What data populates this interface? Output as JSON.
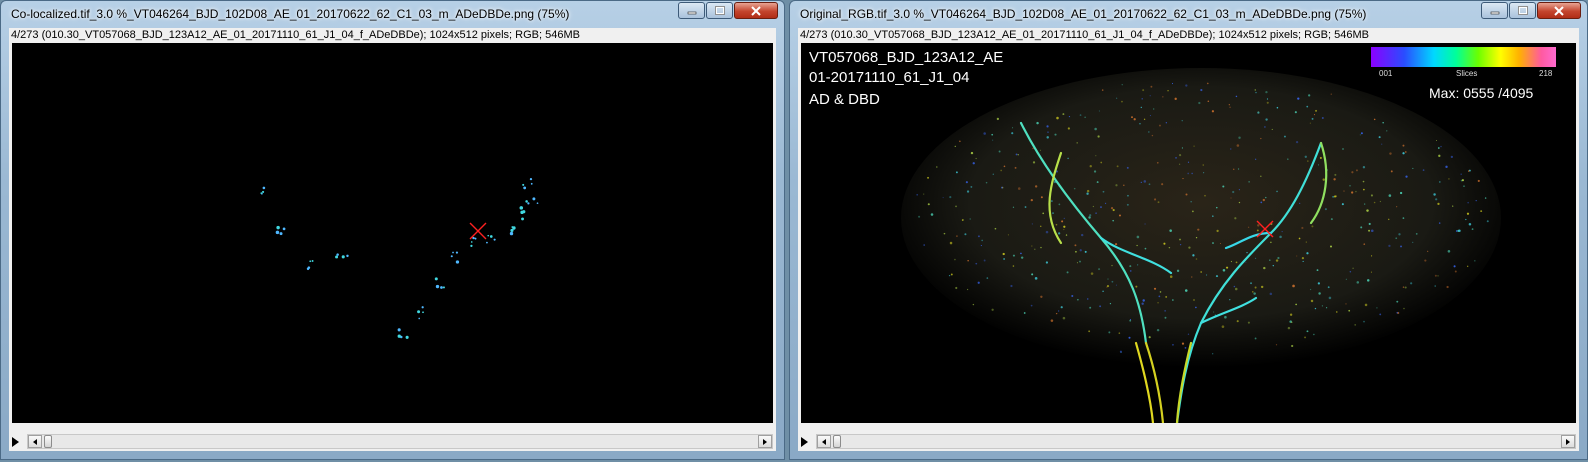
{
  "left_window": {
    "title": "Co-localized.tif_3.0 %_VT046264_BJD_102D08_AE_01_20170622_62_C1_03_m_ADeDBDe.png (75%)",
    "info": "4/273 (010.30_VT057068_BJD_123A12_AE_01_20171110_61_J1_04_f_ADeDBDe); 1024x512 pixels; RGB; 546MB"
  },
  "right_window": {
    "title": "Original_RGB.tif_3.0 %_VT046264_BJD_102D08_AE_01_20170622_62_C1_03_m_ADeDBDe.png (75%)",
    "info": "4/273 (010.30_VT057068_BJD_123A12_AE_01_20171110_61_J1_04_f_ADeDBDe); 1024x512 pixels; RGB; 546MB",
    "overlay_line1": "VT057068_BJD_123A12_AE",
    "overlay_line2": "01-20171110_61_J1_04",
    "overlay_line3": "AD & DBD",
    "colorbar_min": "001",
    "colorbar_mid": "Slices",
    "colorbar_max": "218",
    "max_label": "Max: 0555 /4095"
  },
  "colors": {
    "titlebar": "#9ab8d3",
    "close": "#c4452e",
    "marker": "#ff2020"
  }
}
